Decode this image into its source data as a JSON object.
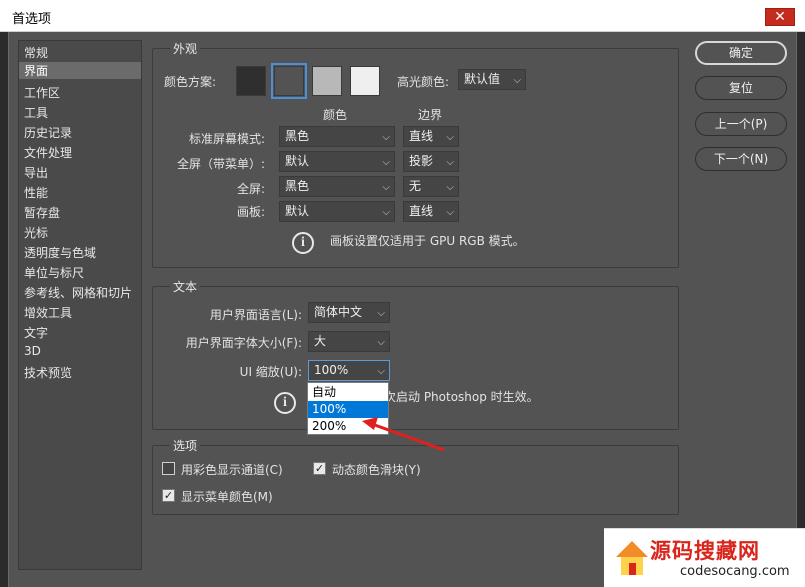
{
  "window": {
    "title": "首选项",
    "close_glyph": "✕"
  },
  "sidebar": {
    "items": [
      "常规",
      "界面",
      "工作区",
      "工具",
      "历史记录",
      "文件处理",
      "导出",
      "性能",
      "暂存盘",
      "光标",
      "透明度与色域",
      "单位与标尺",
      "参考线、网格和切片",
      "增效工具",
      "文字",
      "3D",
      "技术预览"
    ],
    "selected": "界面"
  },
  "appearance": {
    "title": "外观",
    "color_scheme_label": "颜色方案:",
    "swatches": [
      {
        "color": "#2f2f2f",
        "selected": false
      },
      {
        "color": "#535353",
        "selected": true
      },
      {
        "color": "#b8b8b8",
        "selected": false
      },
      {
        "color": "#efefef",
        "selected": false
      }
    ],
    "highlight_label": "高光颜色:",
    "highlight_value": "默认值",
    "col_color": "颜色",
    "col_border": "边界",
    "rows": [
      {
        "label": "标准屏幕模式:",
        "color": "黑色",
        "border": "直线"
      },
      {
        "label": "全屏（带菜单）:",
        "color": "默认",
        "border": "投影"
      },
      {
        "label": "全屏:",
        "color": "黑色",
        "border": "无"
      },
      {
        "label": "画板:",
        "color": "默认",
        "border": "直线"
      }
    ],
    "note": "画板设置仅适用于 GPU RGB 模式。"
  },
  "text": {
    "title": "文本",
    "lang_label": "用户界面语言(L):",
    "lang_value": "简体中文",
    "fontsize_label": "用户界面字体大小(F):",
    "fontsize_value": "大",
    "scale_label": "UI 缩放(U):",
    "scale_value": "100%",
    "scale_options": [
      "自动",
      "100%",
      "200%"
    ],
    "scale_highlighted": "100%",
    "note": "更改将在下一次启动 Photoshop 时生效。"
  },
  "options": {
    "title": "选项",
    "channels_label": "用彩色显示通道(C)",
    "channels_checked": false,
    "dynamic_label": "动态颜色滑块(Y)",
    "dynamic_checked": true,
    "menu_colors_label": "显示菜单颜色(M)",
    "menu_colors_checked": true
  },
  "buttons": {
    "ok": "确定",
    "reset": "复位",
    "prev": "上一个(P)",
    "next": "下一个(N)"
  },
  "watermark": {
    "title": "源码搜藏网",
    "url": "codesocang.com"
  },
  "colors": {
    "dialog_bg": "#535353",
    "highlight": "#0078d7",
    "annotation_arrow": "#e02020"
  }
}
